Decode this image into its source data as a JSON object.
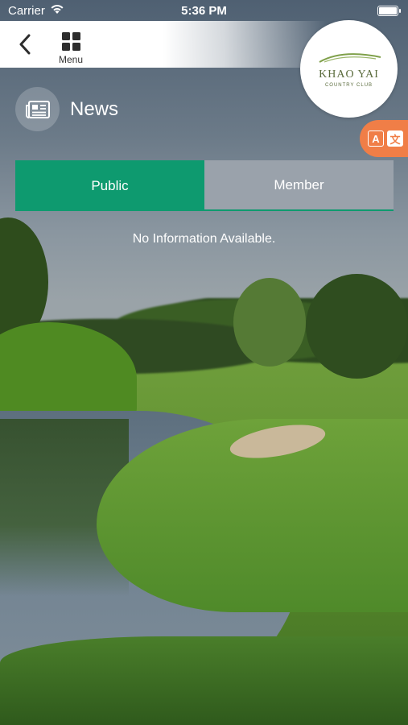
{
  "status_bar": {
    "carrier": "Carrier",
    "time": "5:36 PM"
  },
  "nav": {
    "menu_label": "Menu"
  },
  "logo": {
    "name": "KHAO YAI",
    "subtitle": "COUNTRY CLUB"
  },
  "page": {
    "title": "News"
  },
  "tabs": [
    {
      "label": "Public",
      "selected": true
    },
    {
      "label": "Member",
      "selected": false
    }
  ],
  "content": {
    "empty_message": "No Information Available."
  },
  "translate": {
    "left_glyph": "A",
    "right_glyph": "文"
  },
  "colors": {
    "tab_active": "#0e9a6f",
    "tab_inactive": "#9aa2ab",
    "translate_button": "#f07e47"
  },
  "icons": [
    "wifi-icon",
    "battery-icon",
    "back-arrow-icon",
    "menu-grid-icon",
    "news-icon",
    "translate-icon"
  ]
}
